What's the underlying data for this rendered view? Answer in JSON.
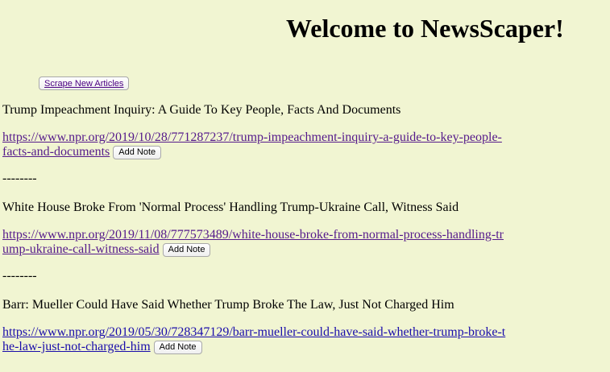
{
  "header": {
    "title": "Welcome to NewsScaper!"
  },
  "actions": {
    "scrape_label": "Scrape New Articles"
  },
  "articles": [
    {
      "title": "Trump Impeachment Inquiry: A Guide To Key People, Facts And Documents",
      "url": "https://www.npr.org/2019/10/28/771287237/trump-impeachment-inquiry-a-guide-to-key-people-facts-and-documents",
      "note_label": "Add Note",
      "separator": "--------"
    },
    {
      "title": "White House Broke From 'Normal Process' Handling Trump-Ukraine Call, Witness Said",
      "url": "https://www.npr.org/2019/11/08/777573489/white-house-broke-from-normal-process-handling-trump-ukraine-call-witness-said",
      "note_label": "Add Note",
      "separator": "--------"
    },
    {
      "title": "Barr: Mueller Could Have Said Whether Trump Broke The Law, Just Not Charged Him",
      "url": "https://www.npr.org/2019/05/30/728347129/barr-mueller-could-have-said-whether-trump-broke-the-law-just-not-charged-him",
      "note_label": "Add Note"
    }
  ],
  "colors": {
    "background": "#f1f5d2",
    "visited_link": "#551a8b",
    "link": "#1a0dab"
  }
}
